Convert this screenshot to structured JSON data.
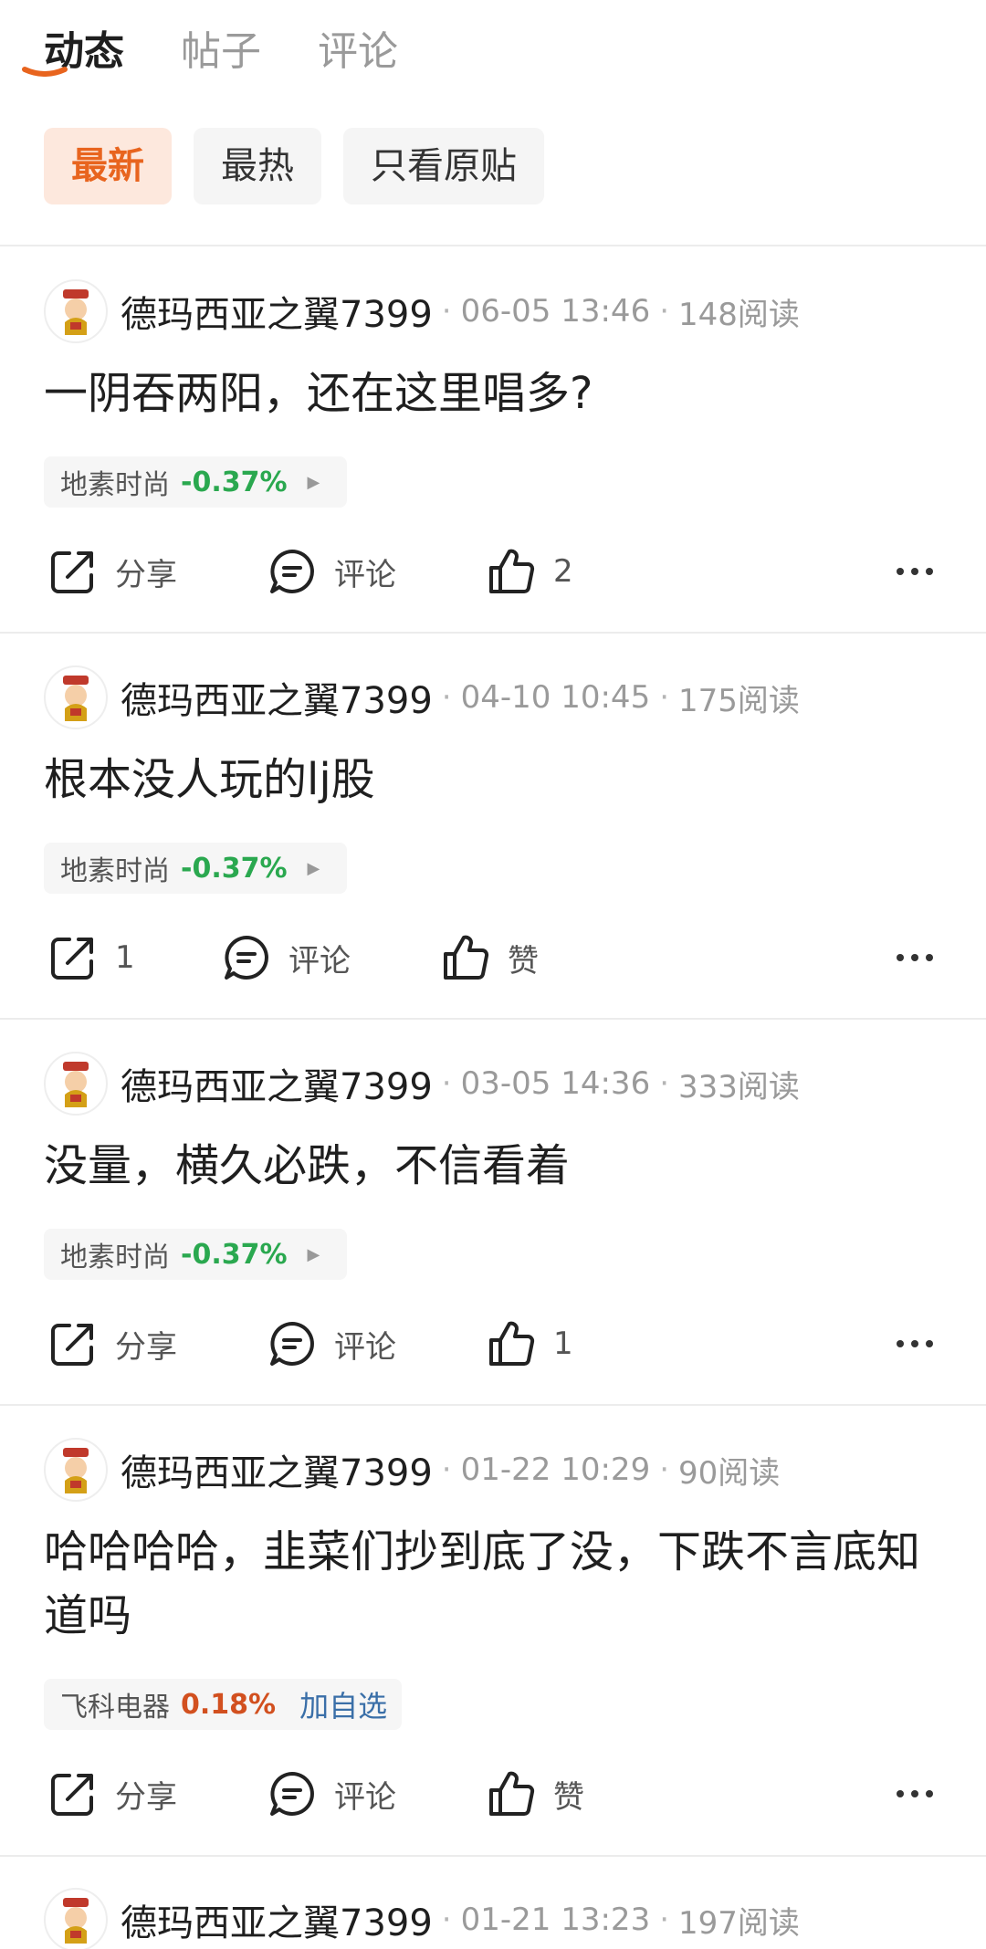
{
  "tabs": [
    {
      "label": "动态"
    },
    {
      "label": "帖子"
    },
    {
      "label": "评论"
    }
  ],
  "filters": [
    {
      "label": "最新"
    },
    {
      "label": "最热"
    },
    {
      "label": "只看原贴"
    }
  ],
  "colors": {
    "accent": "#e8641e",
    "down": "#2aa84f",
    "up": "#d2501f",
    "link": "#3a6fa8"
  },
  "posts": [
    {
      "author": "德玛西亚之翼7399",
      "date": "06-05 13:46",
      "reads": "148阅读",
      "text": "一阴吞两阳，还在这里唱多?",
      "stock": {
        "name": "地素时尚",
        "change": "-0.37%"
      },
      "share": "分享",
      "comment": "评论",
      "like": "2"
    },
    {
      "author": "德玛西亚之翼7399",
      "date": "04-10 10:45",
      "reads": "175阅读",
      "text": "根本没人玩的lj股",
      "stock": {
        "name": "地素时尚",
        "change": "-0.37%"
      },
      "share": "1",
      "comment": "评论",
      "like": "赞"
    },
    {
      "author": "德玛西亚之翼7399",
      "date": "03-05 14:36",
      "reads": "333阅读",
      "text": "没量，横久必跌，不信看着",
      "stock": {
        "name": "地素时尚",
        "change": "-0.37%"
      },
      "share": "分享",
      "comment": "评论",
      "like": "1"
    },
    {
      "author": "德玛西亚之翼7399",
      "date": "01-22 10:29",
      "reads": "90阅读",
      "text": "哈哈哈哈，韭菜们抄到底了没，下跌不言底知道吗",
      "stock": {
        "name": "飞科电器",
        "change": "0.18%",
        "add": "加自选"
      },
      "share": "分享",
      "comment": "评论",
      "like": "赞"
    },
    {
      "author": "德玛西亚之翼7399",
      "date": "01-21 13:23",
      "reads": "197阅读"
    }
  ]
}
